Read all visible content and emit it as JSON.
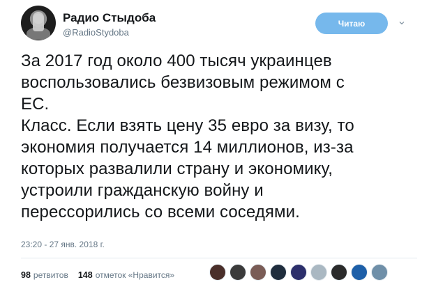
{
  "tweet": {
    "author": {
      "display_name": "Радио Стыдоба",
      "handle": "@RadioStydoba"
    },
    "follow_button": {
      "label": "Читаю",
      "color": "#76b8ec"
    },
    "menu_icon": "chevron-down-icon",
    "text_lines": [
      "За 2017 год около 400 тысяч украинцев",
      "воспользовались безвизовым режимом с",
      "ЕС.",
      "Класс. Если взять цену 35 евро за визу, то",
      "экономия получается 14 миллионов, из-за",
      "которых развалили страну и экономику,",
      "устроили гражданскую войну и",
      "перессорились со всеми соседями."
    ],
    "timestamp": "23:20 - 27 янв. 2018 г.",
    "stats": {
      "retweets_count": "98",
      "retweets_label": "ретвитов",
      "likes_count": "148",
      "likes_label": "отметок «Нравится»"
    },
    "liker_avatars": [
      {
        "name": "liker-avatar-1",
        "color": "#4a2f2a"
      },
      {
        "name": "liker-avatar-2",
        "color": "#3b3b3b"
      },
      {
        "name": "liker-avatar-3",
        "color": "#7a5c56"
      },
      {
        "name": "liker-avatar-4",
        "color": "#1f2d3d"
      },
      {
        "name": "liker-avatar-5",
        "color": "#2c2f6b"
      },
      {
        "name": "liker-avatar-6",
        "color": "#aab8c2"
      },
      {
        "name": "liker-avatar-7",
        "color": "#2b2b2b"
      },
      {
        "name": "liker-avatar-8",
        "color": "#1d5fa8"
      },
      {
        "name": "liker-avatar-9",
        "color": "#6f8fa8"
      }
    ]
  }
}
